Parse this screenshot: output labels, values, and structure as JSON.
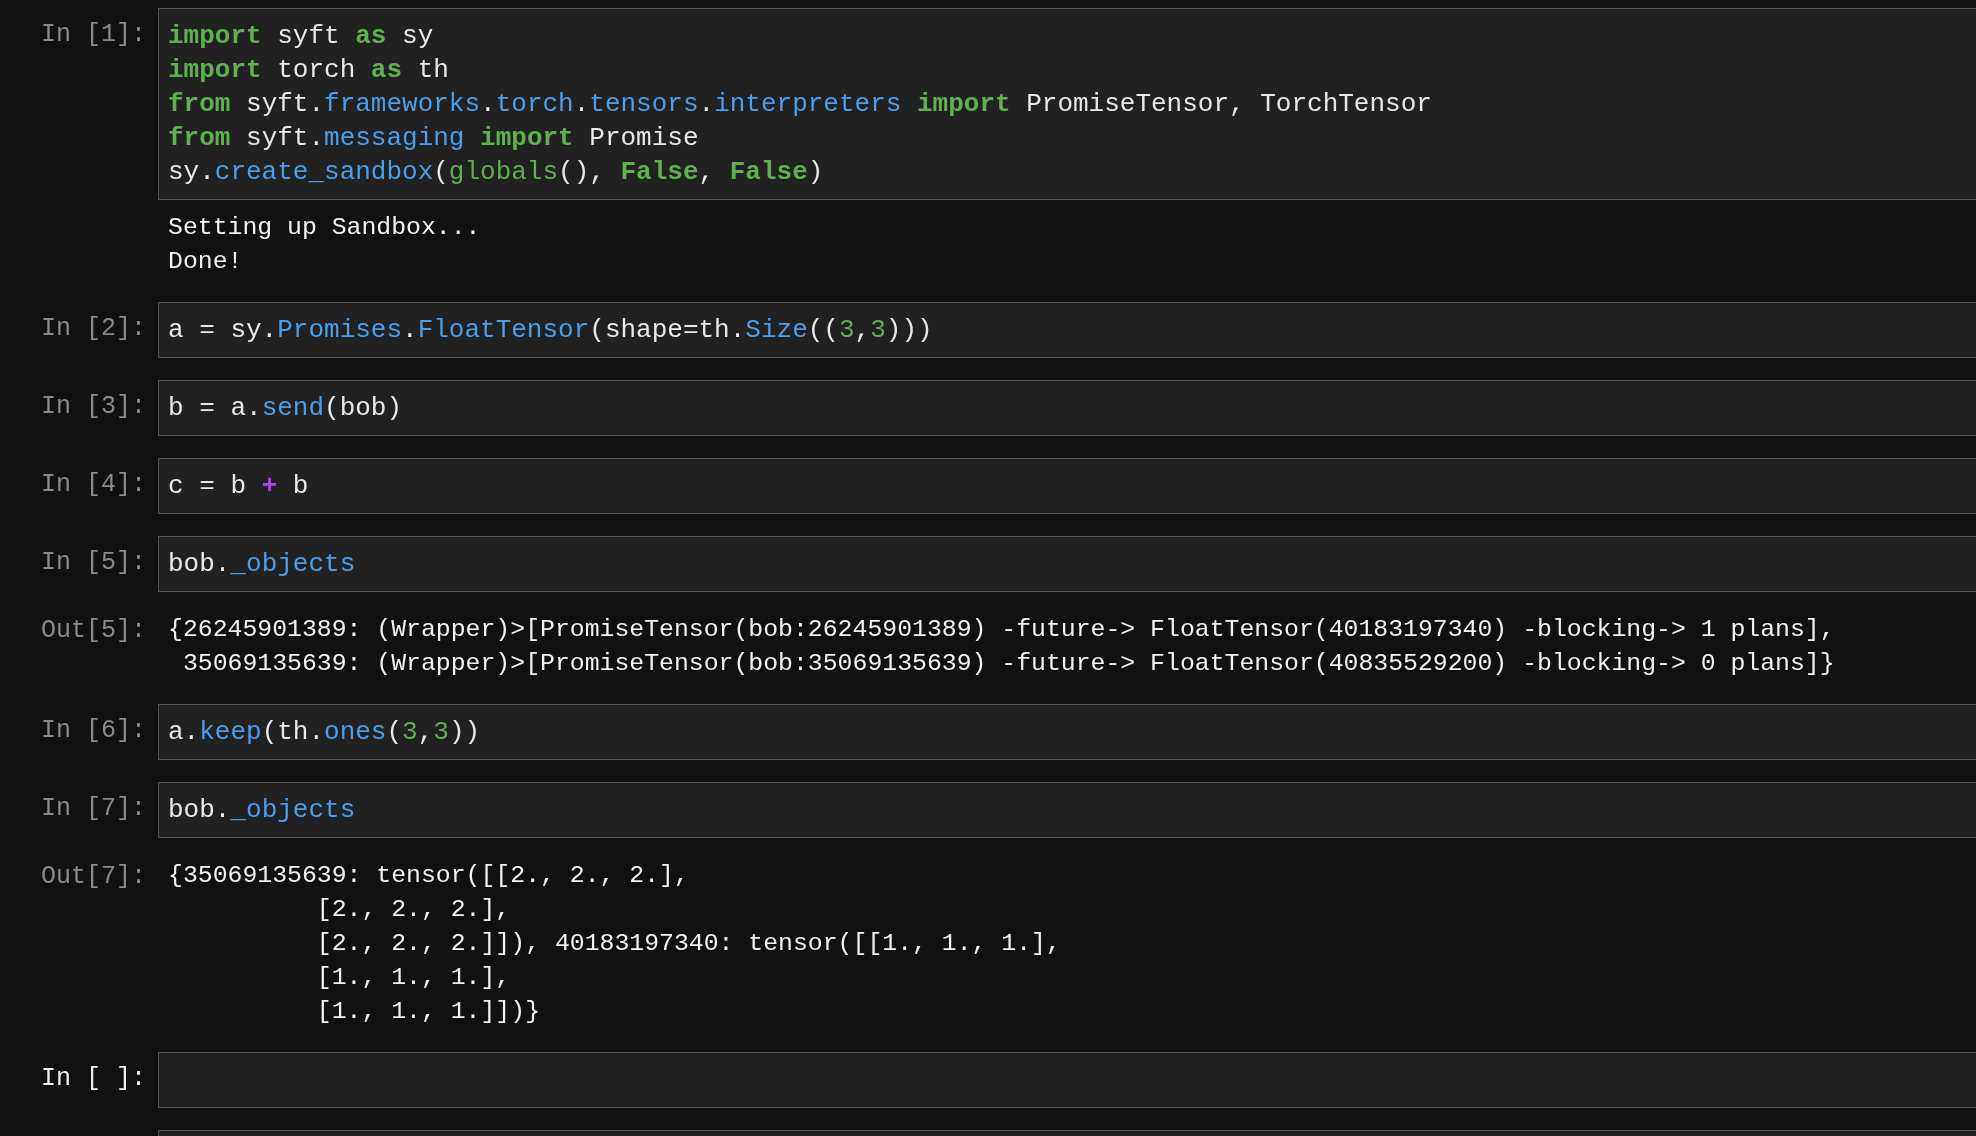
{
  "cells": [
    {
      "kind": "input",
      "prompt": "In [1]:",
      "lines": [
        [
          {
            "kind": "kw",
            "text": "import"
          },
          {
            "kind": "plain",
            "text": " syft "
          },
          {
            "kind": "kw",
            "text": "as"
          },
          {
            "kind": "plain",
            "text": " sy"
          }
        ],
        [
          {
            "kind": "kw",
            "text": "import"
          },
          {
            "kind": "plain",
            "text": " torch "
          },
          {
            "kind": "kw",
            "text": "as"
          },
          {
            "kind": "plain",
            "text": " th"
          }
        ],
        [
          {
            "kind": "kw",
            "text": "from"
          },
          {
            "kind": "plain",
            "text": " syft."
          },
          {
            "kind": "name",
            "text": "frameworks"
          },
          {
            "kind": "plain",
            "text": "."
          },
          {
            "kind": "name",
            "text": "torch"
          },
          {
            "kind": "plain",
            "text": "."
          },
          {
            "kind": "name",
            "text": "tensors"
          },
          {
            "kind": "plain",
            "text": "."
          },
          {
            "kind": "name",
            "text": "interpreters"
          },
          {
            "kind": "kw",
            "text": " import"
          },
          {
            "kind": "plain",
            "text": " PromiseTensor, TorchTensor"
          }
        ],
        [
          {
            "kind": "kw",
            "text": "from"
          },
          {
            "kind": "plain",
            "text": " syft."
          },
          {
            "kind": "name",
            "text": "messaging"
          },
          {
            "kind": "kw",
            "text": " import"
          },
          {
            "kind": "plain",
            "text": " Promise"
          }
        ],
        [
          {
            "kind": "plain",
            "text": "sy."
          },
          {
            "kind": "name",
            "text": "create_sandbox"
          },
          {
            "kind": "plain",
            "text": "("
          },
          {
            "kind": "lit",
            "text": "globals"
          },
          {
            "kind": "plain",
            "text": "(), "
          },
          {
            "kind": "kw",
            "text": "False"
          },
          {
            "kind": "plain",
            "text": ", "
          },
          {
            "kind": "kw",
            "text": "False"
          },
          {
            "kind": "plain",
            "text": ")"
          }
        ]
      ]
    },
    {
      "kind": "stream",
      "lines": [
        "Setting up Sandbox...",
        "Done!"
      ]
    },
    {
      "kind": "input",
      "prompt": "In [2]:",
      "lines": [
        [
          {
            "kind": "plain",
            "text": "a = sy."
          },
          {
            "kind": "name",
            "text": "Promises"
          },
          {
            "kind": "plain",
            "text": "."
          },
          {
            "kind": "name",
            "text": "FloatTensor"
          },
          {
            "kind": "plain",
            "text": "(shape=th."
          },
          {
            "kind": "name",
            "text": "Size"
          },
          {
            "kind": "plain",
            "text": "(("
          },
          {
            "kind": "lit",
            "text": "3"
          },
          {
            "kind": "plain",
            "text": ","
          },
          {
            "kind": "lit",
            "text": "3"
          },
          {
            "kind": "plain",
            "text": ")))"
          }
        ]
      ]
    },
    {
      "kind": "input",
      "prompt": "In [3]:",
      "lines": [
        [
          {
            "kind": "plain",
            "text": "b = a."
          },
          {
            "kind": "name",
            "text": "send"
          },
          {
            "kind": "plain",
            "text": "(bob)"
          }
        ]
      ]
    },
    {
      "kind": "input",
      "prompt": "In [4]:",
      "lines": [
        [
          {
            "kind": "plain",
            "text": "c = b "
          },
          {
            "kind": "op",
            "text": "+"
          },
          {
            "kind": "plain",
            "text": " b"
          }
        ]
      ]
    },
    {
      "kind": "input",
      "prompt": "In [5]:",
      "lines": [
        [
          {
            "kind": "plain",
            "text": "bob."
          },
          {
            "kind": "name",
            "text": "_objects"
          }
        ]
      ]
    },
    {
      "kind": "result",
      "prompt": "Out[5]:",
      "lines": [
        "{26245901389: (Wrapper)>[PromiseTensor(bob:26245901389) -future-> FloatTensor(40183197340) -blocking-> 1 plans],",
        " 35069135639: (Wrapper)>[PromiseTensor(bob:35069135639) -future-> FloatTensor(40835529200) -blocking-> 0 plans]}"
      ]
    },
    {
      "kind": "input",
      "prompt": "In [6]:",
      "lines": [
        [
          {
            "kind": "plain",
            "text": "a."
          },
          {
            "kind": "name",
            "text": "keep"
          },
          {
            "kind": "plain",
            "text": "(th."
          },
          {
            "kind": "name",
            "text": "ones"
          },
          {
            "kind": "plain",
            "text": "("
          },
          {
            "kind": "lit",
            "text": "3"
          },
          {
            "kind": "plain",
            "text": ","
          },
          {
            "kind": "lit",
            "text": "3"
          },
          {
            "kind": "plain",
            "text": "))"
          }
        ]
      ]
    },
    {
      "kind": "input",
      "prompt": "In [7]:",
      "lines": [
        [
          {
            "kind": "plain",
            "text": "bob."
          },
          {
            "kind": "name",
            "text": "_objects"
          }
        ]
      ]
    },
    {
      "kind": "result",
      "prompt": "Out[7]:",
      "lines": [
        "{35069135639: tensor([[2., 2., 2.],",
        "          [2., 2., 2.],",
        "          [2., 2., 2.]]), 40183197340: tensor([[1., 1., 1.],",
        "          [1., 1., 1.],",
        "          [1., 1., 1.]])}"
      ]
    },
    {
      "kind": "empty_input",
      "prompt": "In [ ]:"
    },
    {
      "kind": "blank_input"
    }
  ]
}
